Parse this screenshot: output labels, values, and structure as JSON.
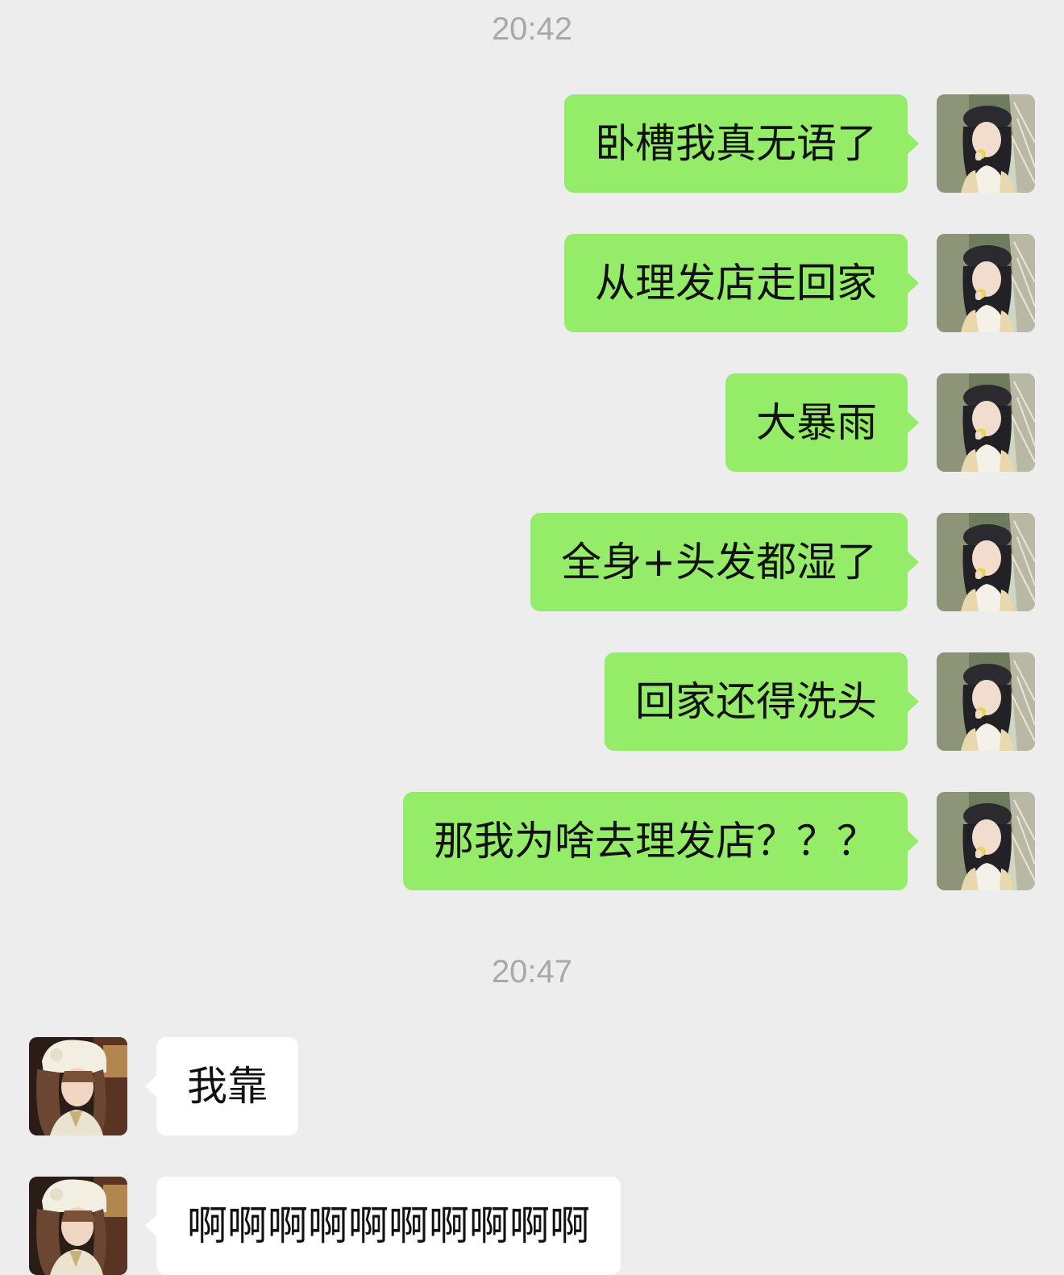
{
  "colors": {
    "background": "#ededed",
    "outgoing_bubble": "#95ec69",
    "incoming_bubble": "#ffffff",
    "timestamp_text": "#a8a8a8"
  },
  "timestamps": [
    "20:42",
    "20:47"
  ],
  "outgoing_messages": [
    {
      "text": "卧槽我真无语了",
      "avatar": "self-avatar-girl-dark-hat"
    },
    {
      "text": "从理发店走回家",
      "avatar": "self-avatar-girl-dark-hat"
    },
    {
      "text": "大暴雨",
      "avatar": "self-avatar-girl-dark-hat"
    },
    {
      "text": "全身+头发都湿了",
      "avatar": "self-avatar-girl-dark-hat"
    },
    {
      "text": "回家还得洗头",
      "avatar": "self-avatar-girl-dark-hat"
    },
    {
      "text": "那我为啥去理发店？？？",
      "avatar": "self-avatar-girl-dark-hat"
    }
  ],
  "incoming_messages": [
    {
      "text": "我靠",
      "avatar": "contact-avatar-girl-white-hat"
    },
    {
      "text": "啊啊啊啊啊啊啊啊啊啊",
      "avatar": "contact-avatar-girl-white-hat"
    }
  ]
}
